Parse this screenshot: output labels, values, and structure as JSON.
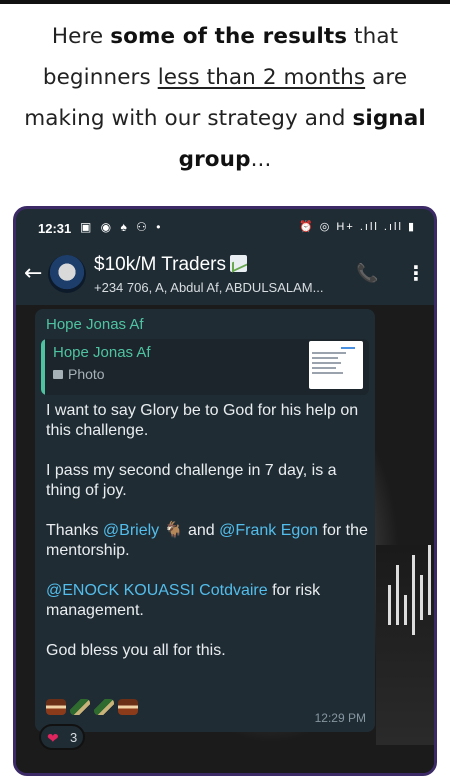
{
  "headline": {
    "part1": "Here ",
    "bold1": "some of the results",
    "part2": " that beginners ",
    "underline": "less than 2 months",
    "part3": " are making with our strategy and ",
    "bold2": "signal group",
    "part4": "..."
  },
  "status_bar": {
    "time": "12:31",
    "left_icons": "▣ ◉ ♠ ⚇ •",
    "right_icons": "⏰ ◎ H+ .ıll .ıll ▮"
  },
  "chat_header": {
    "title": "$10k/M Traders",
    "subtitle": "+234 706, A, Abdul Af, ABDULSALAM..."
  },
  "message": {
    "sender": "Hope Jonas Af",
    "quoted_sender": "Hope Jonas Af",
    "quoted_type": "Photo",
    "line1": "I want to say Glory be to God for his help on this challenge.",
    "line2": "I pass my second challenge in 7 day, is a thing of joy.",
    "thanks_prefix": "Thanks ",
    "mention1": "@Briely",
    "thanks_mid": " 🐐 and ",
    "mention2": "@Frank Egon",
    "thanks_suffix": " for the mentorship.",
    "mention3": "@ENOCK KOUASSI Cotdvaire",
    "risk_suffix": " for risk management.",
    "line5": "God bless you all for this.",
    "time": "12:29 PM"
  },
  "reaction": {
    "emoji": "❤",
    "count": "3"
  },
  "colors": {
    "chat_bg": "#1f2c34",
    "accent_green": "#4fc3a1",
    "mention_blue": "#53bdeb",
    "frame": "#3b2a66"
  }
}
